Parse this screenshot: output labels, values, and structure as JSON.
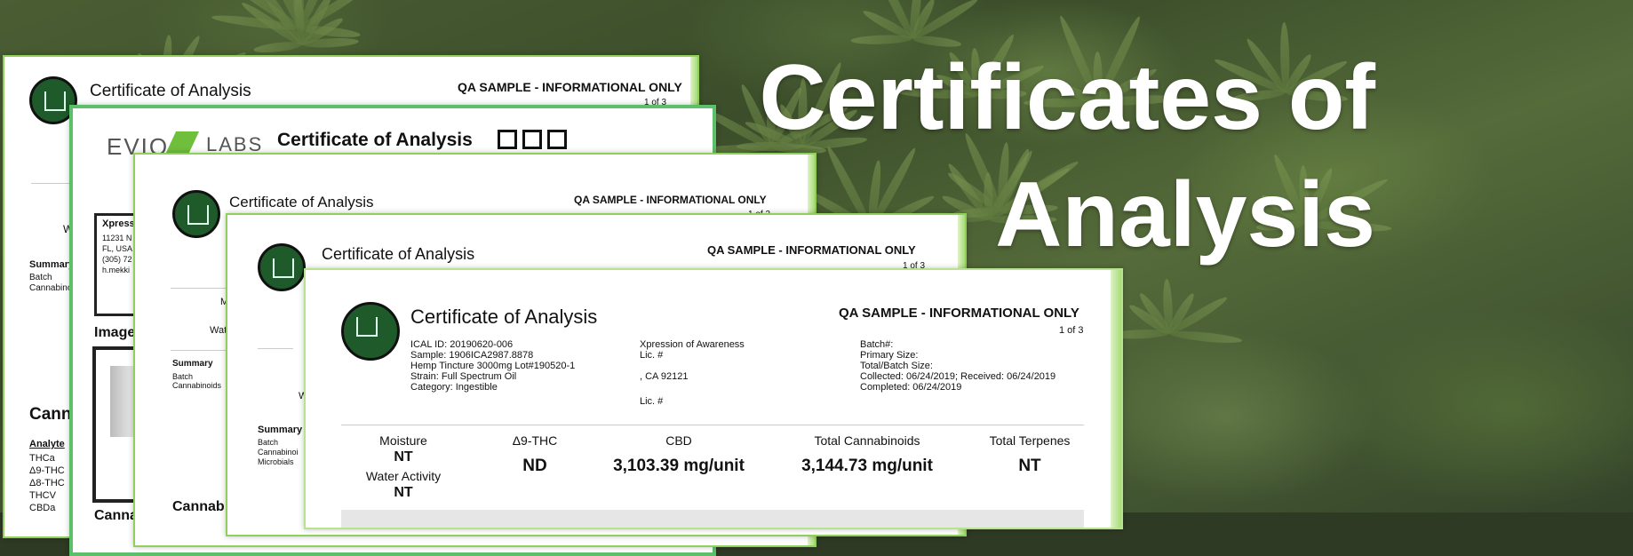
{
  "headline": {
    "line1": "Certificates of",
    "line2": "Analysis"
  },
  "cards": {
    "c1": {
      "title": "Certificate of Analysis",
      "qa": "QA SAMPLE - INFORMATIONAL ONLY",
      "page": "1 of 3",
      "side_w": "W",
      "summary": "Summary",
      "batch": "Batch",
      "cannabinoids": "Cannabino",
      "section": "Cann",
      "analyte": "Analyte",
      "analytes": [
        "THCa",
        "Δ9-THC",
        "Δ8-THC",
        "THCV",
        "CBDa"
      ]
    },
    "c2": {
      "brand": "EVIO",
      "brand2": "LABS",
      "title": "Certificate of Analysis",
      "client": "Xpress",
      "addr1": "11231 N",
      "addr2": "FL, USA",
      "addr3": "(305) 72",
      "addr4": "h.mekki",
      "image": "Image",
      "bottom": "Canna"
    },
    "c3": {
      "title": "Certificate of Analysis",
      "qa": "QA SAMPLE - INFORMATIONAL ONLY",
      "page": "1 of 3",
      "m": "M",
      "wat": "Wat",
      "summary": "Summary",
      "batch": "Batch",
      "cannabinoids": "Cannabinoids",
      "bottom": "Cannab"
    },
    "c4": {
      "title": "Certificate of Analysis",
      "qa": "QA SAMPLE - INFORMATIONAL ONLY",
      "page": "1 of 3",
      "w": "W",
      "summary": "Summary",
      "batch": "Batch",
      "cannabinoids": "Cannabinoi",
      "microbials": "Microbials"
    },
    "c5": {
      "title": "Certificate of Analysis",
      "qa": "QA SAMPLE - INFORMATIONAL ONLY",
      "page": "1 of 3",
      "col1": [
        "ICAL ID: 20190620-006",
        "Sample: 1906ICA2987.8878",
        "Hemp Tincture 3000mg Lot#190520-1",
        "Strain: Full Spectrum Oil",
        "Category: Ingestible"
      ],
      "col2": [
        "Xpression of Awareness",
        "Lic. #",
        "",
        ", CA 92121",
        "",
        "Lic. #"
      ],
      "col3": [
        "Batch#:",
        "Primary Size:",
        "Total/Batch Size:",
        "Collected: 06/24/2019; Received: 06/24/2019",
        "Completed: 06/24/2019"
      ],
      "moisture_label": "Moisture",
      "moisture_value": "NT",
      "water_label": "Water Activity",
      "water_value": "NT",
      "thc_label": "Δ9-THC",
      "thc_value": "ND",
      "cbd_label": "CBD",
      "cbd_value": "3,103.39 mg/unit",
      "tc_label": "Total Cannabinoids",
      "tc_value": "3,144.73 mg/unit",
      "tt_label": "Total Terpenes",
      "tt_value": "NT"
    }
  }
}
